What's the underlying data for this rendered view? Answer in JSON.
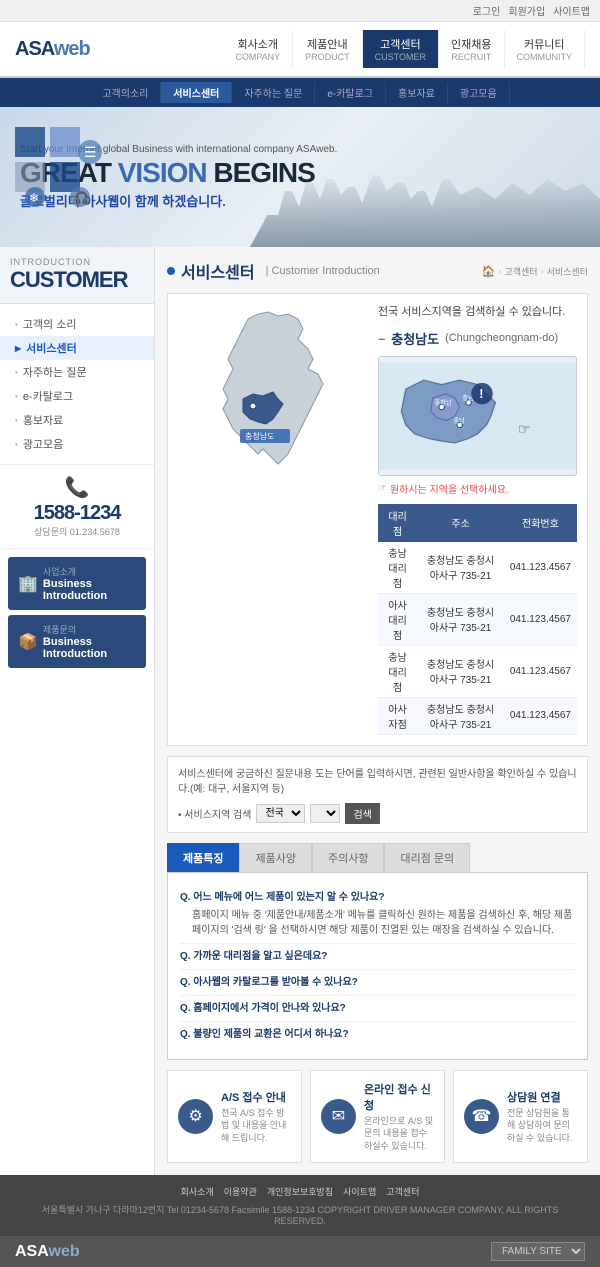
{
  "topBar": {
    "items": [
      "로그인",
      "회원가입",
      "사이트맵"
    ]
  },
  "header": {
    "logo": "ASAweb",
    "logoSub": "web",
    "navItems": [
      {
        "label": "회사소개",
        "sub": "COMPANY"
      },
      {
        "label": "제품안내",
        "sub": "PRODUCT"
      },
      {
        "label": "고객센터",
        "sub": "CUSTOMER",
        "active": true
      },
      {
        "label": "인재채용",
        "sub": "RECRUIT"
      },
      {
        "label": "커뮤니티",
        "sub": "COMMUNITY"
      }
    ]
  },
  "subNav": {
    "items": [
      {
        "label": "고객의소리"
      },
      {
        "label": "서비스센터",
        "active": true
      },
      {
        "label": "자주하는 질문"
      },
      {
        "label": "e-카탈로그"
      },
      {
        "label": "홍보자료"
      },
      {
        "label": "광고모음"
      }
    ]
  },
  "hero": {
    "smallText": "Start your Internet global Business with international company ASAweb.",
    "titlePart1": "GREAT ",
    "titlePart2": "VISION",
    "titlePart3": " BEGINS",
    "subtitle": "글로벌리더 아사웹이 함께 하겠습니다.",
    "desc": "글로벌리더 아사웹이 함께 하겠습니다."
  },
  "sidebar": {
    "introLabel": "INTRODUCTION",
    "introTitle": "CUSTOMER",
    "menuItems": [
      {
        "label": "고객의 소리",
        "active": false
      },
      {
        "label": "서비스센터",
        "active": true
      },
      {
        "label": "자주하는 질문",
        "active": false
      },
      {
        "label": "e-카탈로그",
        "active": false
      },
      {
        "label": "홍보자료",
        "active": false
      },
      {
        "label": "광고모음",
        "active": false
      }
    ],
    "phoneNumber": "1588-1234",
    "phoneLabel": "상담문의 01.234.5678",
    "links": [
      {
        "sub": "사업소개",
        "main": "Business Introduction"
      },
      {
        "sub": "제품문의",
        "main": "Business Introduction"
      }
    ]
  },
  "content": {
    "sectionTitle": "서비스센터",
    "sectionSub": "Customer Introduction",
    "breadcrumb": [
      "고객센터",
      "서비스센터"
    ],
    "serviceDesc": "전국 서비스지역을 검색하실 수 있습니다.",
    "regionTitle": "충청남도",
    "regionNameKo": "(Chungcheongnam-do)",
    "regionLabels": [
      "충청남",
      "충청남",
      "충남",
      "충남",
      "충남"
    ],
    "selectHint": "원하시는 지역을 선택하세요.",
    "tableHeaders": [
      "대리점",
      "주소",
      "전화번호"
    ],
    "tableRows": [
      [
        "충남대리점",
        "충청남도 충청시 아사구 735-21",
        "041.123.4567"
      ],
      [
        "아사대리점",
        "충청남도 충청시 아사구 735-21",
        "041.123.4567"
      ],
      [
        "충남대리점",
        "충청남도 충청시 아사구 735-21",
        "041.123.4567"
      ],
      [
        "아사자점",
        "충청남도 충청시 아사구 735-21",
        "041.123.4567"
      ]
    ],
    "searchDesc": "서비스센터에 궁금하신 질문내용 도는 단어를 입력하시면, 관련된 일반사항을 확인하실 수 있습니다.(예: 대구, 서울지역 등)",
    "searchLabel": "• 서비스지역 검색",
    "searchOptions": [
      "전국"
    ],
    "searchPlaceholder": "",
    "searchButton": "검색",
    "faqTabs": [
      "제품특징",
      "제품사양",
      "주의사항",
      "대리점 문의"
    ],
    "faqItems": [
      {
        "q": "Q. 어느 메뉴에 어느 제품이 있는지 알 수 있나요?",
        "a": "홈페이지 메뉴 중 '제품안내/제품소개' 메뉴를 클릭하신 원하는 제품을 검색하신 후, 해당 제품 페이지의 '검색 링' 을 선택하시면 해당 제품이 진열된 있는 매장을 검색하실 수 있습니다."
      },
      {
        "q": "Q. 가까운 대리점을 알고 싶은데요?",
        "a": ""
      },
      {
        "q": "Q. 아사웹의 카탈로그를 받아볼 수 있나요?",
        "a": ""
      },
      {
        "q": "Q. 홈페이지에서 가격이 안나와 있나요?",
        "a": ""
      },
      {
        "q": "Q. 불량인 제품의 교환은 어디서 하나요?",
        "a": ""
      }
    ],
    "banners": [
      {
        "icon": "⚙",
        "title": "A/S 접수 안내",
        "desc": "전국 A/S 접수 방법 및\n내용을 안내해 드립니다."
      },
      {
        "icon": "✉",
        "title": "온라인 접수 신청",
        "desc": "온라인으로 A/S 및 문의\n내용을 접수 하실수 있습니다."
      },
      {
        "icon": "☎",
        "title": "상담원 연결",
        "desc": "전문 상담원을 통해 상담하여\n문의하실 수 있습니다."
      }
    ]
  },
  "footer": {
    "navItems": [
      "회사소개",
      "이용약관",
      "개인정보보호방침",
      "사이트맵",
      "고객센터"
    ],
    "address": "서울특별시 가나구 다라마12번지 Tel 01234-5678  Facsimile 1588-1234   COPYRIGHT DRIVER MANAGER COMPANY, ALL RIGHTS RESERVED.",
    "logo": "ASAweb",
    "familySite": "FAMILY SITE"
  }
}
